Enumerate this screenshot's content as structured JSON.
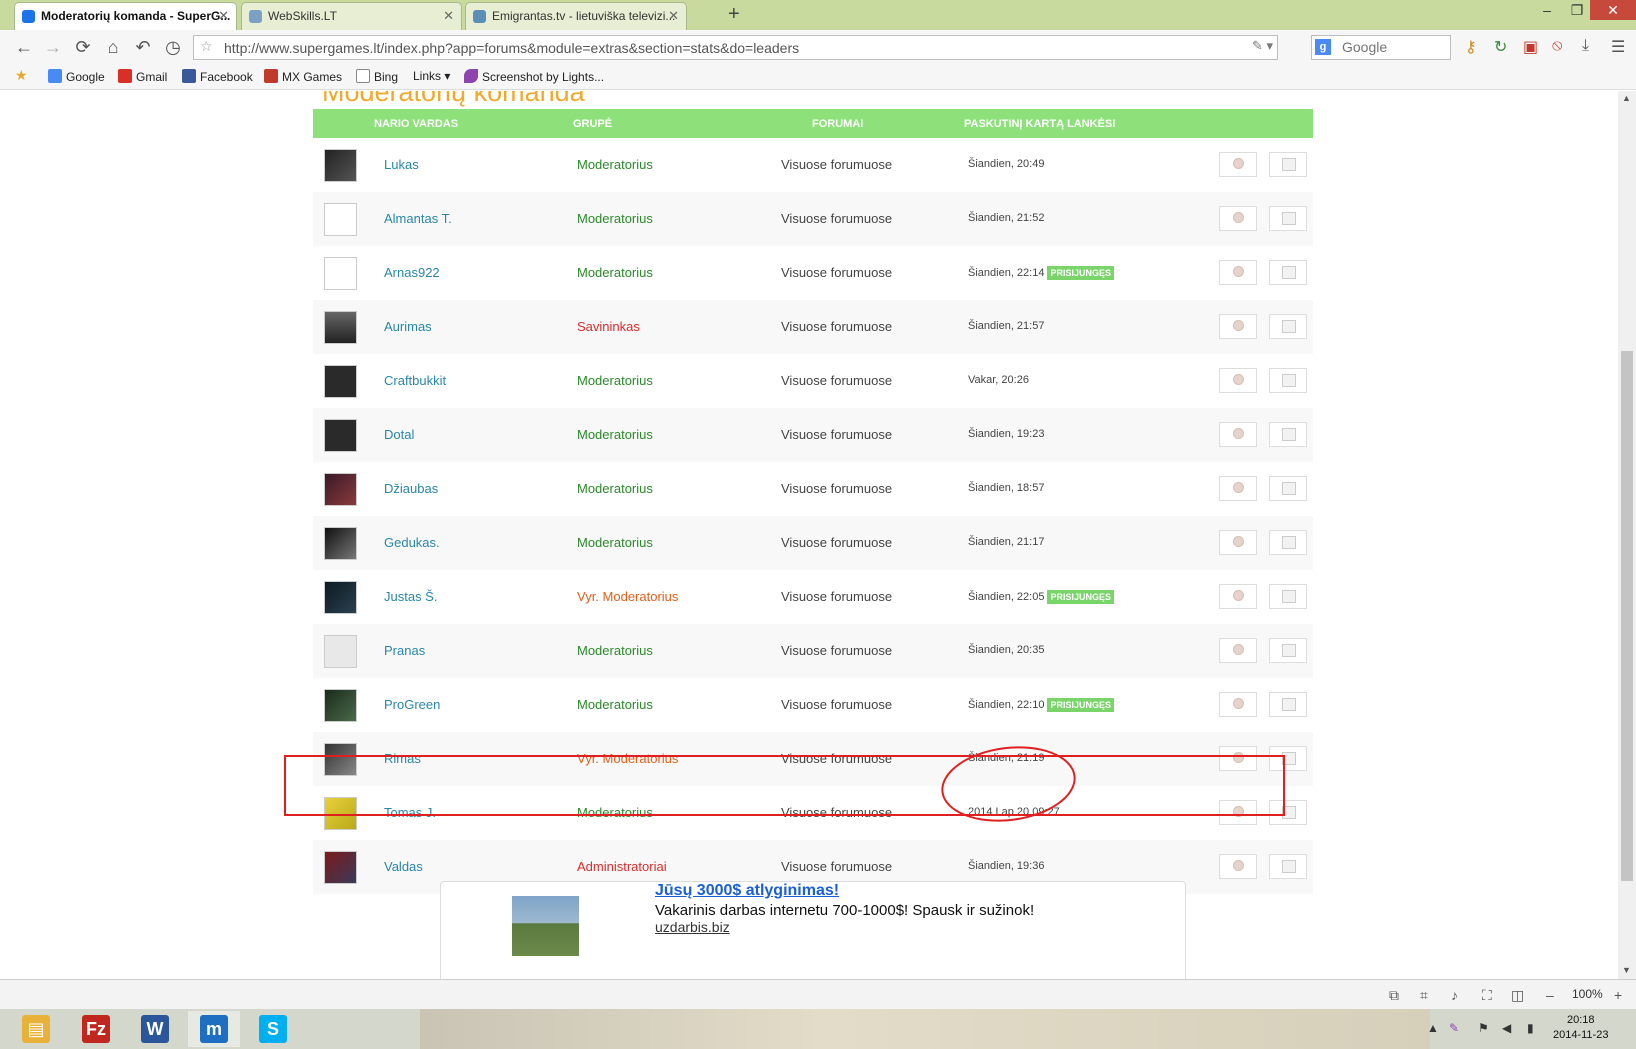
{
  "browser": {
    "tabs": [
      {
        "title": "Moderatorių komanda - SuperG...",
        "active": true,
        "favicon_color": "#1a73e8"
      },
      {
        "title": "WebSkills.LT",
        "active": false,
        "favicon_color": "#7aa0c4"
      },
      {
        "title": "Emigrantas.tv - lietuviška televizi...",
        "active": false,
        "favicon_color": "#5c8fb8"
      }
    ],
    "tab_close": "✕",
    "new_tab": "+",
    "url": "http://www.supergames.lt/index.php?app=forums&module=extras&section=stats&do=leaders",
    "search_placeholder": "Google",
    "bookmarks": [
      {
        "label": "Google",
        "icon": "google-icon",
        "color": "#4a8af4"
      },
      {
        "label": "Gmail",
        "icon": "gmail-icon",
        "color": "#d93025"
      },
      {
        "label": "Facebook",
        "icon": "facebook-icon",
        "color": "#3b5998"
      },
      {
        "label": "MX Games",
        "icon": "mxgames-icon",
        "color": "#c0392b"
      },
      {
        "label": "Bing",
        "icon": "page-icon",
        "color": "#ffffff"
      },
      {
        "label": "Links",
        "icon": "folder-icon",
        "color": "#f6f6f6"
      },
      {
        "label": "Screenshot by Lights...",
        "icon": "feather-icon",
        "color": "#8e44ad"
      }
    ],
    "zoom": "100%"
  },
  "page": {
    "heading": "Moderatorių komanda",
    "columns": {
      "name": "NARIO VARDAS",
      "group": "GRUPĖ",
      "forums": "FORUMAI",
      "last": "PASKUTINĮ KARTĄ LANKĖSI"
    },
    "online_badge": "PRISIJUNGĘS",
    "members": [
      {
        "name": "Lukas",
        "group": "Moderatorius",
        "group_type": "moder",
        "forums": "Visuose forumuose",
        "last": "Šiandien, 20:49",
        "online": false
      },
      {
        "name": "Almantas T.",
        "group": "Moderatorius",
        "group_type": "moder",
        "forums": "Visuose forumuose",
        "last": "Šiandien, 21:52",
        "online": false
      },
      {
        "name": "Arnas922",
        "group": "Moderatorius",
        "group_type": "moder",
        "forums": "Visuose forumuose",
        "last": "Šiandien, 22:14",
        "online": true
      },
      {
        "name": "Aurimas",
        "group": "Savininkas",
        "group_type": "owner",
        "forums": "Visuose forumuose",
        "last": "Šiandien, 21:57",
        "online": false
      },
      {
        "name": "Craftbukkit",
        "group": "Moderatorius",
        "group_type": "moder",
        "forums": "Visuose forumuose",
        "last": "Vakar, 20:26",
        "online": false
      },
      {
        "name": "Dotal",
        "group": "Moderatorius",
        "group_type": "moder",
        "forums": "Visuose forumuose",
        "last": "Šiandien, 19:23",
        "online": false
      },
      {
        "name": "Džiaubas",
        "group": "Moderatorius",
        "group_type": "moder",
        "forums": "Visuose forumuose",
        "last": "Šiandien, 18:57",
        "online": false
      },
      {
        "name": "Gedukas.",
        "group": "Moderatorius",
        "group_type": "moder",
        "forums": "Visuose forumuose",
        "last": "Šiandien, 21:17",
        "online": false
      },
      {
        "name": "Justas Š.",
        "group": "Vyr. Moderatorius",
        "group_type": "vyr",
        "forums": "Visuose forumuose",
        "last": "Šiandien, 22:05",
        "online": true
      },
      {
        "name": "Pranas",
        "group": "Moderatorius",
        "group_type": "moder",
        "forums": "Visuose forumuose",
        "last": "Šiandien, 20:35",
        "online": false
      },
      {
        "name": "ProGreen",
        "group": "Moderatorius",
        "group_type": "moder",
        "forums": "Visuose forumuose",
        "last": "Šiandien, 22:10",
        "online": true
      },
      {
        "name": "Rimas",
        "group": "Vyr. Moderatorius",
        "group_type": "vyr",
        "forums": "Visuose forumuose",
        "last": "Šiandien, 21:19",
        "online": false
      },
      {
        "name": "Tomas J.",
        "group": "Moderatorius",
        "group_type": "moder",
        "forums": "Visuose forumuose",
        "last": "2014 Lap 20 09:27",
        "online": false
      },
      {
        "name": "Valdas",
        "group": "Administratoriai",
        "group_type": "admin",
        "forums": "Visuose forumuose",
        "last": "Šiandien, 19:36",
        "online": false
      }
    ],
    "ad": {
      "title": "Jūsų 3000$ atlyginimas!",
      "text": "Vakarinis darbas internetu 700-1000$! Spausk ir sužinok!",
      "link": "uzdarbis.biz"
    }
  },
  "taskbar": {
    "apps": [
      {
        "name": "file-explorer",
        "color": "#e8b23a",
        "glyph": "▤"
      },
      {
        "name": "filezilla",
        "color": "#c0271f",
        "glyph": "Fz"
      },
      {
        "name": "word",
        "color": "#2b579a",
        "glyph": "W"
      },
      {
        "name": "maxthon",
        "color": "#1e6fc2",
        "glyph": "m"
      },
      {
        "name": "skype",
        "color": "#00aff0",
        "glyph": "S"
      }
    ],
    "time": "20:18",
    "date": "2014-11-23"
  }
}
